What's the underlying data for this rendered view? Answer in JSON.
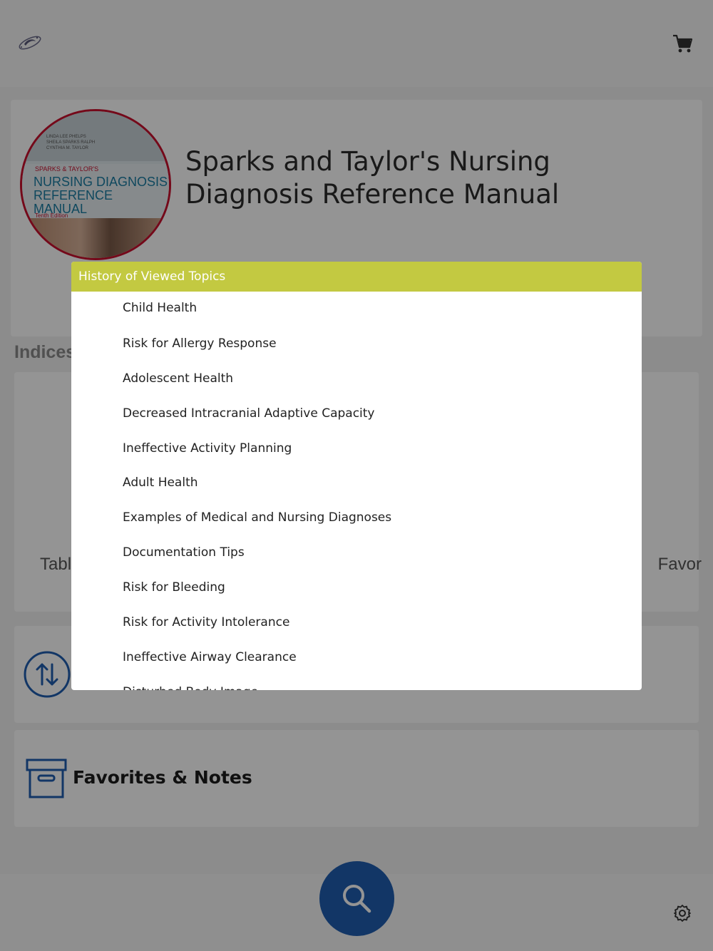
{
  "header": {
    "logo_icon": "galaxy-logo-icon",
    "cart_icon": "cart-icon"
  },
  "book": {
    "title": "Sparks and Taylor's Nursing Diagnosis Reference Manual",
    "cover": {
      "authors": "LINDA LEE PHELPS\nSHEILA SPARKS RALPH\nCYNTHIA M. TAYLOR",
      "subtitle": "SPARKS & TAYLOR'S",
      "title": "NURSING DIAGNOSIS\nREFERENCE MANUAL",
      "edition": "Tenth Edition"
    }
  },
  "indices": {
    "section_label": "Indices",
    "left_label": "Tabl",
    "right_label": "Favor"
  },
  "favorites": {
    "label": "Favorites & Notes",
    "icon": "archive-box-icon"
  },
  "sync": {
    "icon": "sync-arrows-icon"
  },
  "bottom": {
    "search_icon": "search-icon",
    "settings_icon": "gear-icon"
  },
  "modal": {
    "title": "History of Viewed Topics",
    "items": [
      "Child Health",
      "Risk for Allergy Response",
      "Adolescent Health",
      "Decreased Intracranial Adaptive Capacity",
      "Ineffective Activity Planning",
      "Adult Health",
      "Examples of Medical and Nursing Diagnoses",
      "Documentation Tips",
      "Risk for Bleeding",
      "Risk for Activity Intolerance",
      "Ineffective Airway Clearance",
      "Disturbed Body Image"
    ]
  },
  "colors": {
    "modal_header": "#c3c941",
    "accent_blue": "#1f5eb0",
    "cover_border": "#c8102e"
  }
}
